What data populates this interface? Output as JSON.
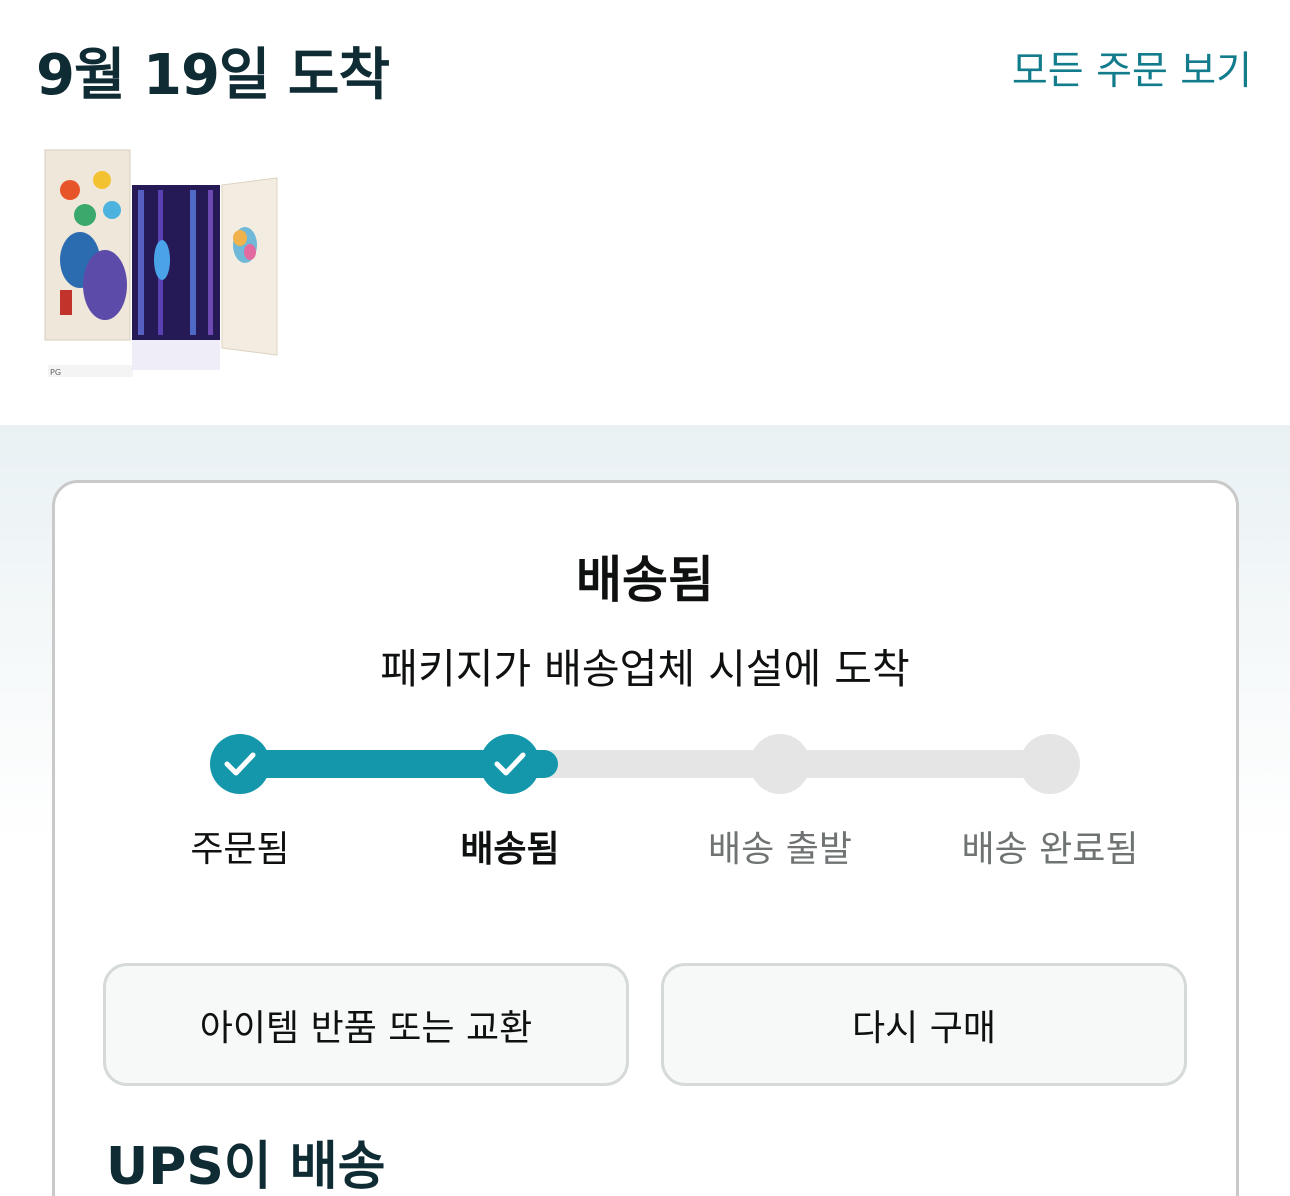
{
  "header": {
    "arrival_title": "9월 19일 도착",
    "all_orders_link": "모든 주문 보기"
  },
  "shipment": {
    "status_title": "배송됨",
    "status_detail": "패키지가 배송업체 시설에 도착"
  },
  "tracker": {
    "progress_fraction": 0.39,
    "steps": [
      {
        "label": "주문됨",
        "state": "done"
      },
      {
        "label": "배송됨",
        "state": "current"
      },
      {
        "label": "배송 출발",
        "state": "pending"
      },
      {
        "label": "배송 완료됨",
        "state": "pending"
      }
    ]
  },
  "actions": {
    "return_button": "아이템 반품 또는 교환",
    "buy_again_button": "다시 구매"
  },
  "carrier": {
    "heading": "UPS이 배송"
  },
  "colors": {
    "accent": "#1597ab",
    "link": "#127c8c",
    "heading": "#0f2b33",
    "rail": "#e6e5e6"
  }
}
